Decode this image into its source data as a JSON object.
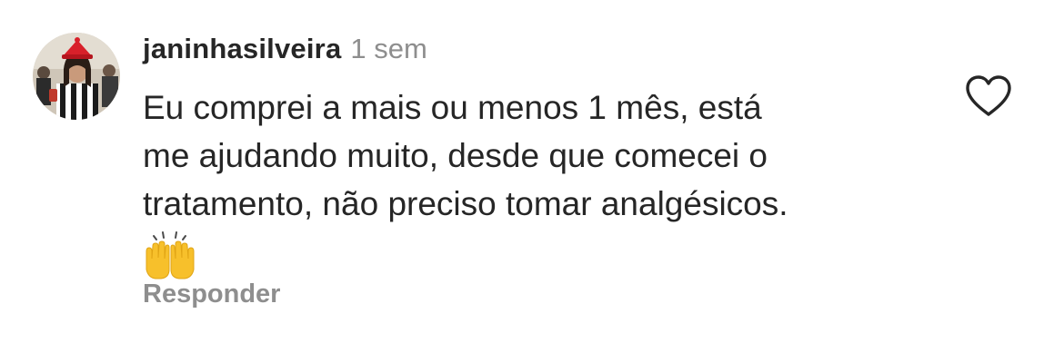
{
  "comment": {
    "username": "janinhasilveira",
    "timestamp": "1 sem",
    "text_lines": [
      "Eu comprei a mais ou menos 1 mês, está",
      "me ajudando muito, desde que comecei o",
      "tratamento, não preciso tomar analgésicos."
    ],
    "emoji": "🙌",
    "reply_label": "Responder",
    "avatar_icon": "user-avatar-photo",
    "like_icon": "heart-outline-icon"
  },
  "colors": {
    "text_primary": "#262626",
    "text_secondary": "#8e8e8e",
    "background": "#ffffff"
  }
}
